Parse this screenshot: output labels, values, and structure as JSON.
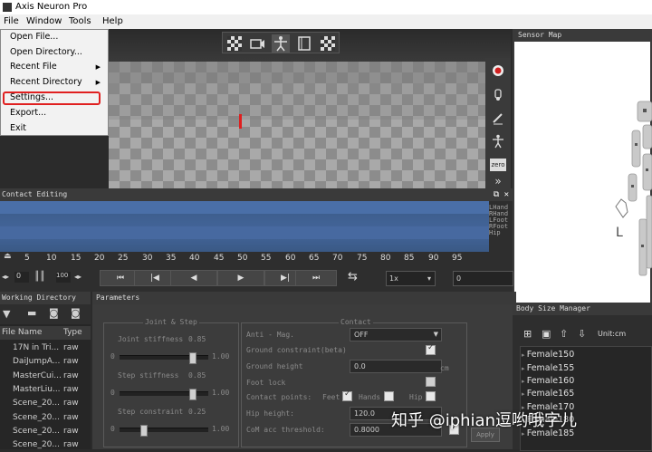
{
  "app": {
    "title": "Axis Neuron Pro"
  },
  "menubar": {
    "file": "File",
    "window": "Window",
    "tools": "Tools",
    "help": "Help"
  },
  "file_menu": {
    "items": [
      "Open File...",
      "Open Directory...",
      "Recent File",
      "Recent Directory",
      "Settings...",
      "Export...",
      "Exit"
    ]
  },
  "sensor_map": {
    "title": "Sensor Map",
    "side_label": "L"
  },
  "viewport": {
    "zero_label": "zero"
  },
  "contact_editing": {
    "title": "Contact Editing",
    "tracks": [
      "LHand",
      "RHand",
      "LFoot",
      "RFoot",
      "Hip"
    ],
    "ruler_ticks": [
      "5",
      "10",
      "15",
      "20",
      "25",
      "30",
      "35",
      "40",
      "45",
      "50",
      "55",
      "60",
      "65",
      "70",
      "75",
      "80",
      "85",
      "90",
      "95"
    ],
    "range_start": "0",
    "range_end": "100",
    "speed": "1x",
    "frame": "0"
  },
  "working_directory": {
    "title": "Working Directory",
    "col_name": "File Name",
    "col_type": "Type",
    "rows": [
      {
        "name": "17N in Tri...",
        "type": "raw"
      },
      {
        "name": "DaiJumpA...",
        "type": "raw"
      },
      {
        "name": "MasterCui...",
        "type": "raw"
      },
      {
        "name": "MasterLiu...",
        "type": "raw"
      },
      {
        "name": "Scene_20...",
        "type": "raw"
      },
      {
        "name": "Scene_20...",
        "type": "raw"
      },
      {
        "name": "Scene_20...",
        "type": "raw"
      },
      {
        "name": "Scene_20...",
        "type": "raw"
      }
    ]
  },
  "parameters": {
    "title": "Parameters",
    "joint_step": {
      "legend": "Joint & Step",
      "joint_stiffness_label": "Joint stiffness",
      "joint_stiffness_value": "0.85",
      "step_stiffness_label": "Step stiffness",
      "step_stiffness_value": "0.85",
      "step_constraint_label": "Step constraint",
      "step_constraint_value": "0.25",
      "min": "0",
      "max": "1.00",
      "joint_stiffness_level": 0.85,
      "step_stiffness_level": 0.85,
      "step_constraint_level": 0.25
    },
    "contact": {
      "legend": "Contact",
      "anti_mag_label": "Anti - Mag.",
      "anti_mag_value": "OFF",
      "ground_constraint_label": "Ground constraint(beta)",
      "ground_height_label": "Ground height",
      "ground_height_value": "0.0",
      "ground_height_unit": "cm",
      "foot_lock_label": "Foot lock",
      "contact_points_label": "Contact points:",
      "feet_label": "Feet",
      "hands_label": "Hands",
      "hip_label": "Hip",
      "hip_height_label": "Hip height:",
      "hip_height_value": "120.0",
      "com_acc_label": "CoM acc threshold:",
      "com_acc_value": "0.8000",
      "apply_label": "Apply"
    }
  },
  "body_size_manager": {
    "title": "Body Size Manager",
    "unit_label": "Unit:cm",
    "items": [
      "Female150",
      "Female155",
      "Female160",
      "Female165",
      "Female170",
      "Female180",
      "Female185"
    ]
  },
  "watermark": {
    "text": "知乎 @iphian逗哟哦字儿"
  }
}
